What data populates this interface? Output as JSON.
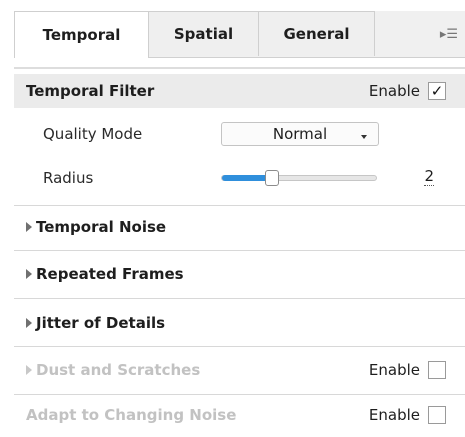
{
  "tabs": [
    {
      "label": "Temporal",
      "active": true
    },
    {
      "label": "Spatial",
      "active": false
    },
    {
      "label": "General",
      "active": false
    }
  ],
  "tab_menu_icon": "panel-menu-icon",
  "temporal_filter": {
    "title": "Temporal Filter",
    "enable_label": "Enable",
    "enabled": true,
    "check_glyph": "✓",
    "quality_mode": {
      "label": "Quality Mode",
      "value": "Normal"
    },
    "radius": {
      "label": "Radius",
      "value": "2",
      "level": 0.3
    }
  },
  "sections": [
    {
      "title": "Temporal Noise",
      "disabled": false
    },
    {
      "title": "Repeated Frames",
      "disabled": false
    },
    {
      "title": "Jitter of Details",
      "disabled": false
    },
    {
      "title": "Dust and Scratches",
      "disabled": true,
      "enable_label": "Enable",
      "enabled": false
    },
    {
      "title": "Adapt to Changing Noise",
      "disabled": true,
      "enable_label": "Enable",
      "enabled": false
    }
  ],
  "colors": {
    "accent": "#2f8fdc",
    "disabled_text": "#c2c2c2"
  }
}
